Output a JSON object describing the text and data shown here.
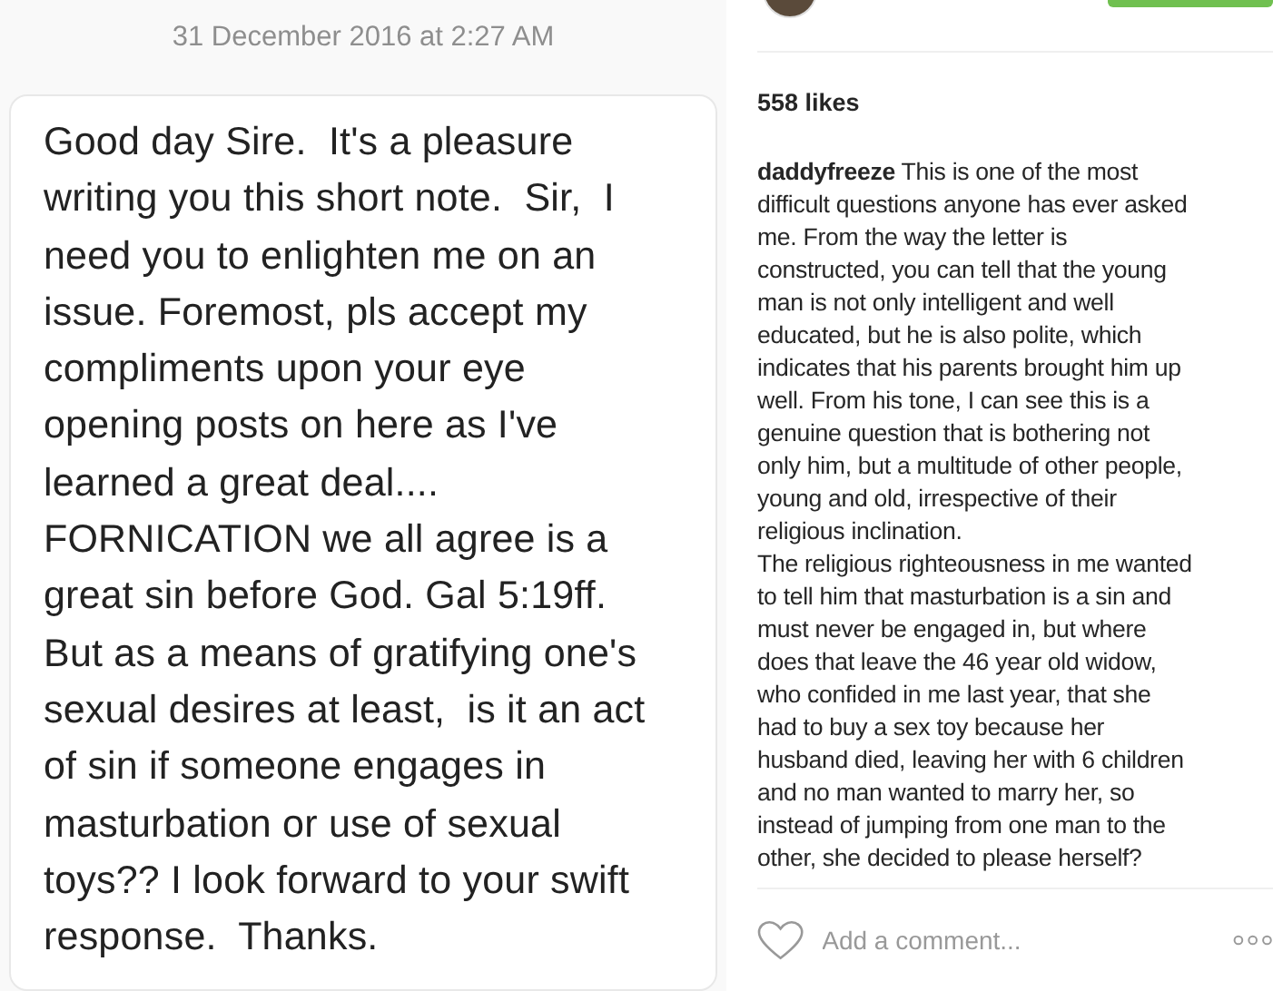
{
  "message": {
    "timestamp": "31 December 2016 at 2:27 AM",
    "lines": [
      "Good day Sire.  It's a pleasure",
      "writing you this short note.  Sir,  I",
      "need you to enlighten me on an",
      "issue. Foremost, pls accept my",
      "compliments upon your eye",
      "opening posts on here as I've",
      "learned a great deal....",
      "FORNICATION we all agree is a",
      "great sin before God. Gal 5:19ff.",
      "But as a means of gratifying one's",
      "sexual desires at least,  is it an act",
      "of sin if someone engages in",
      "masturbation or use of sexual",
      "toys?? I look forward to your swift",
      "response.  Thanks."
    ]
  },
  "post": {
    "likes": "558 likes",
    "username": "daddyfreeze",
    "caption_lines": [
      " This is one of the most",
      "difficult questions anyone has ever asked",
      "me. From the way the letter is",
      "constructed, you can tell that the young",
      "man is not only intelligent and well",
      "educated, but he is also polite, which",
      "indicates that his parents brought him up",
      "well. From his tone, I can see this is a",
      "genuine question that is bothering not",
      "only him, but a multitude of other people,",
      "young and old, irrespective of their",
      "religious inclination.",
      "The religious righteousness in me wanted",
      "to tell him that masturbation is a sin and",
      "must never be engaged in, but where",
      "does that leave the 46 year old widow,",
      "who confided in me last year, that she",
      "had to buy a sex toy because her",
      "husband died, leaving her with 6 children",
      "and no man wanted to marry her, so",
      "instead of jumping from one man to the",
      "other, she decided to please herself?"
    ],
    "comment": {
      "placeholder": "Add a comment..."
    },
    "liked": false
  }
}
